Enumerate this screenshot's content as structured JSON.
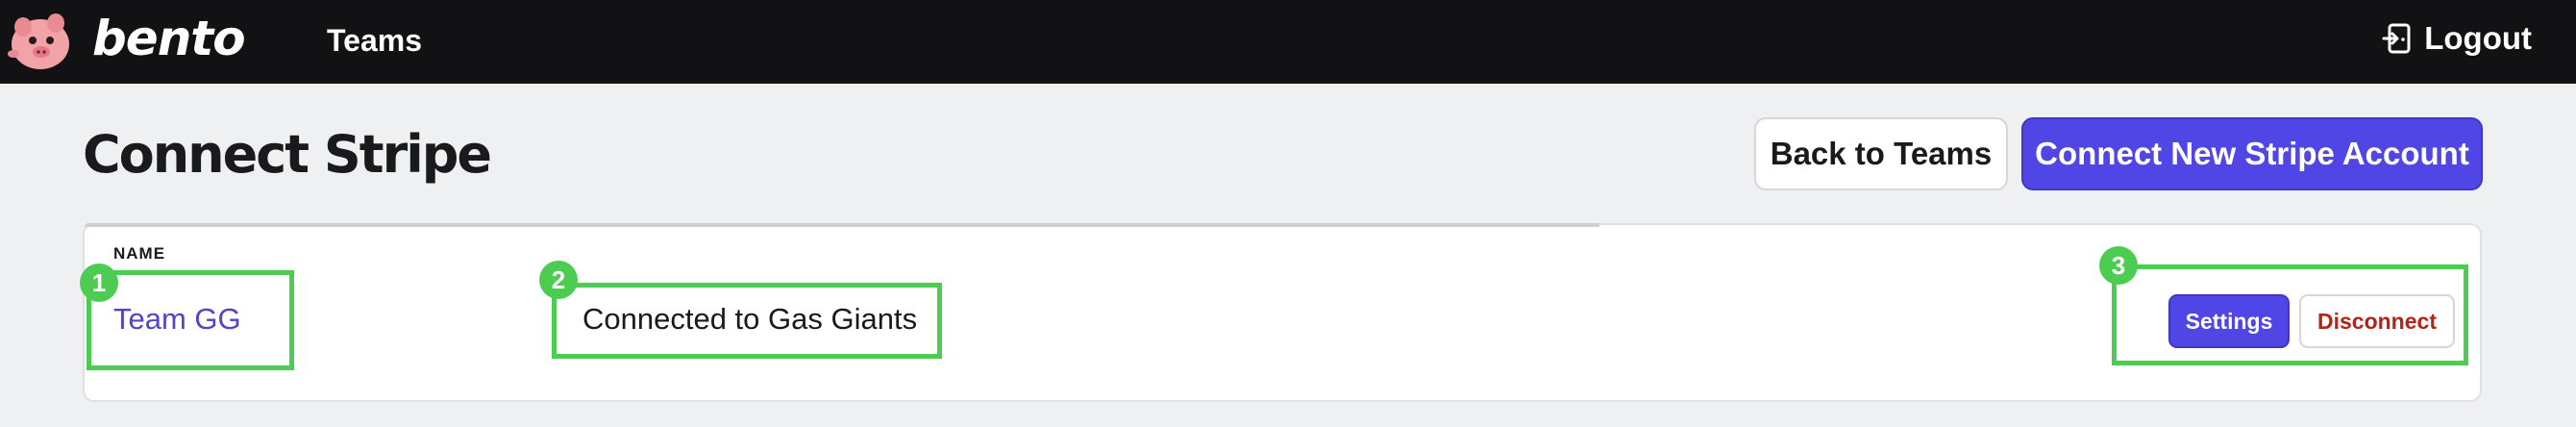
{
  "header": {
    "brand": "bento",
    "nav_item": "Teams",
    "logout_label": "Logout",
    "logo_icon": "pig-mascot-icon",
    "logout_icon": "logout-door-icon"
  },
  "page": {
    "title": "Connect Stripe",
    "back_label": "Back to Teams",
    "connect_label": "Connect New Stripe Account"
  },
  "table": {
    "columns": [
      "NAME"
    ],
    "rows": [
      {
        "name": "Team GG",
        "status": "Connected to Gas Giants",
        "settings_label": "Settings",
        "disconnect_label": "Disconnect"
      }
    ]
  },
  "annotations": [
    "1",
    "2",
    "3"
  ],
  "colors": {
    "accent": "#5046e5",
    "danger": "#b42318",
    "annotation": "#4dcc52",
    "topbar": "#121214"
  }
}
